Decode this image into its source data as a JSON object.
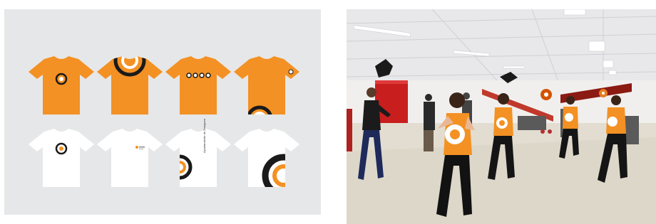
{
  "left_panel": {
    "background": "#e6e7e8",
    "shirt_colors": {
      "orange": "#f39124",
      "white": "#ffffff",
      "black": "#1a1a1a"
    },
    "print_text": "Ayuntamiento de Zaragoza"
  },
  "right_panel": {
    "scene": "aerobics class in gym with orange t-shirts"
  }
}
